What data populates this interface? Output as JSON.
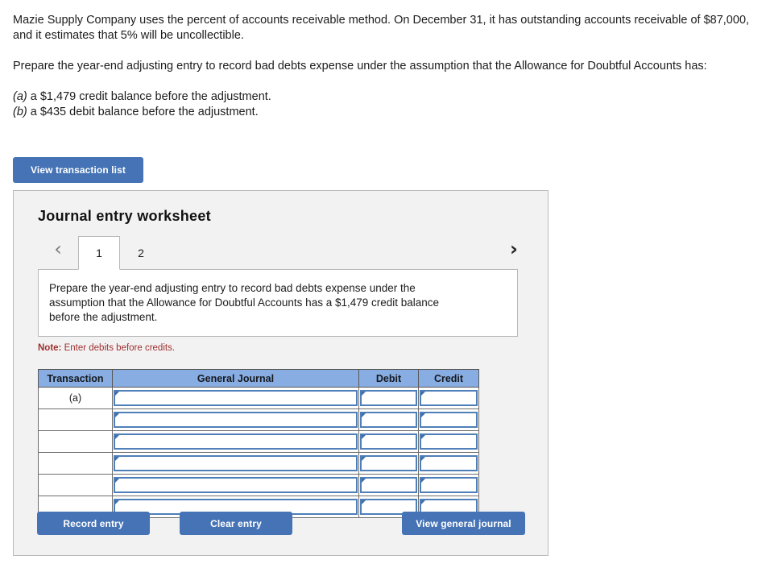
{
  "problem": {
    "paragraph1": "Mazie Supply Company uses the percent of accounts receivable method. On December 31, it has outstanding accounts receivable of $87,000, and it estimates that 5% will be uncollectible.",
    "paragraph2": "Prepare the year-end adjusting entry to record bad debts expense under the assumption that the Allowance for Doubtful Accounts has:",
    "item_a_label": "(a)",
    "item_a_text": " a $1,479 credit balance before the adjustment.",
    "item_b_label": "(b)",
    "item_b_text": " a $435 debit balance before the adjustment."
  },
  "toolbar": {
    "view_transaction_list_label": "View transaction list"
  },
  "worksheet": {
    "title": "Journal entry worksheet",
    "prev_icon": "chevron-left",
    "next_icon": "chevron-right",
    "prev_glyph": "‹",
    "next_glyph": "›",
    "tabs": [
      {
        "label": "1",
        "active": true
      },
      {
        "label": "2",
        "active": false
      }
    ],
    "instruction": "Prepare the year-end adjusting entry to record bad debts expense under the assumption that the Allowance for Doubtful Accounts has a $1,479 credit balance before the adjustment.",
    "note_prefix": "Note:",
    "note_text": " Enter debits before credits.",
    "table": {
      "columns": [
        "Transaction",
        "General Journal",
        "Debit",
        "Credit"
      ],
      "rows": [
        {
          "transaction": "(a)",
          "general_journal": "",
          "debit": "",
          "credit": ""
        },
        {
          "transaction": "",
          "general_journal": "",
          "debit": "",
          "credit": ""
        },
        {
          "transaction": "",
          "general_journal": "",
          "debit": "",
          "credit": ""
        },
        {
          "transaction": "",
          "general_journal": "",
          "debit": "",
          "credit": ""
        },
        {
          "transaction": "",
          "general_journal": "",
          "debit": "",
          "credit": ""
        },
        {
          "transaction": "",
          "general_journal": "",
          "debit": "",
          "credit": ""
        }
      ]
    },
    "footer": {
      "record_entry_label": "Record entry",
      "clear_entry_label": "Clear entry",
      "view_general_journal_label": "View general journal"
    }
  },
  "colors": {
    "accent_blue": "#4573b5",
    "table_header_blue": "#88ade2",
    "input_border_blue": "#4f7fb8",
    "panel_background": "#f2f2f2",
    "note_red": "#a03030"
  }
}
